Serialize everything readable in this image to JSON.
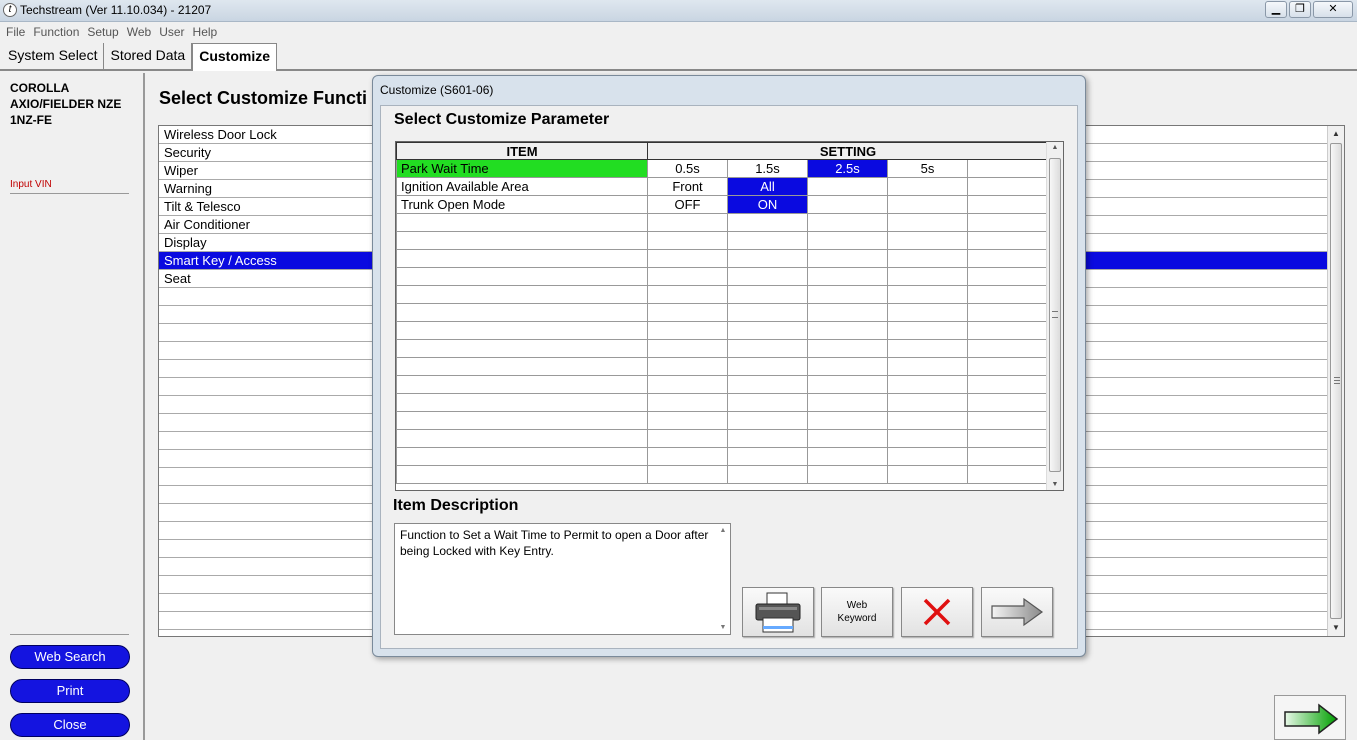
{
  "window": {
    "title": "Techstream (Ver 11.10.034) - 21207",
    "icon": "techstream-icon",
    "controls": [
      "minimize",
      "maximize",
      "close"
    ]
  },
  "menu": [
    "File",
    "Function",
    "Setup",
    "Web",
    "User",
    "Help"
  ],
  "tabs": [
    {
      "label": "System Select",
      "active": false
    },
    {
      "label": "Stored Data",
      "active": false
    },
    {
      "label": "Customize",
      "active": true
    }
  ],
  "left_panel": {
    "vehicle_line1": "COROLLA",
    "vehicle_line2": "AXIO/FIELDER NZE",
    "vehicle_line3": "1NZ-FE",
    "input_vin": "Input VIN",
    "web_search": "Web Search",
    "print": "Print",
    "close": "Close",
    "button_color": "#1414e0"
  },
  "main": {
    "title": "Select Customize Functi",
    "functions": [
      "Wireless Door Lock",
      "Security",
      "Wiper",
      "Warning",
      "Tilt & Telesco",
      "Air Conditioner",
      "Display",
      "Smart Key / Access",
      "Seat"
    ],
    "selected_function": "Smart Key / Access",
    "selection_color": "#0a0ae0",
    "next_icon": "green-arrow-right-icon"
  },
  "dialog": {
    "title": "Customize (S601-06)",
    "heading": "Select Customize Parameter",
    "col_item": "ITEM",
    "col_setting": "SETTING",
    "rows": [
      {
        "item": "Park Wait Time",
        "settings": [
          "0.5s",
          "1.5s",
          "2.5s",
          "5s",
          ""
        ],
        "selected": "2.5s",
        "active": true
      },
      {
        "item": "Ignition Available Area",
        "settings": [
          "Front",
          "All",
          "",
          "",
          ""
        ],
        "selected": "All",
        "active": false
      },
      {
        "item": "Trunk Open Mode",
        "settings": [
          "OFF",
          "ON",
          "",
          "",
          ""
        ],
        "selected": "ON",
        "active": false
      }
    ],
    "active_row_color": "#22dd22",
    "description_label": "Item Description",
    "description": "Function to Set a Wait Time to Permit to open a Door after being Locked with Key Entry.",
    "buttons": {
      "print_icon": "printer-icon",
      "web_keyword": "Web Keyword",
      "cancel_icon": "red-x-icon",
      "next_icon": "gray-arrow-right-icon"
    }
  }
}
